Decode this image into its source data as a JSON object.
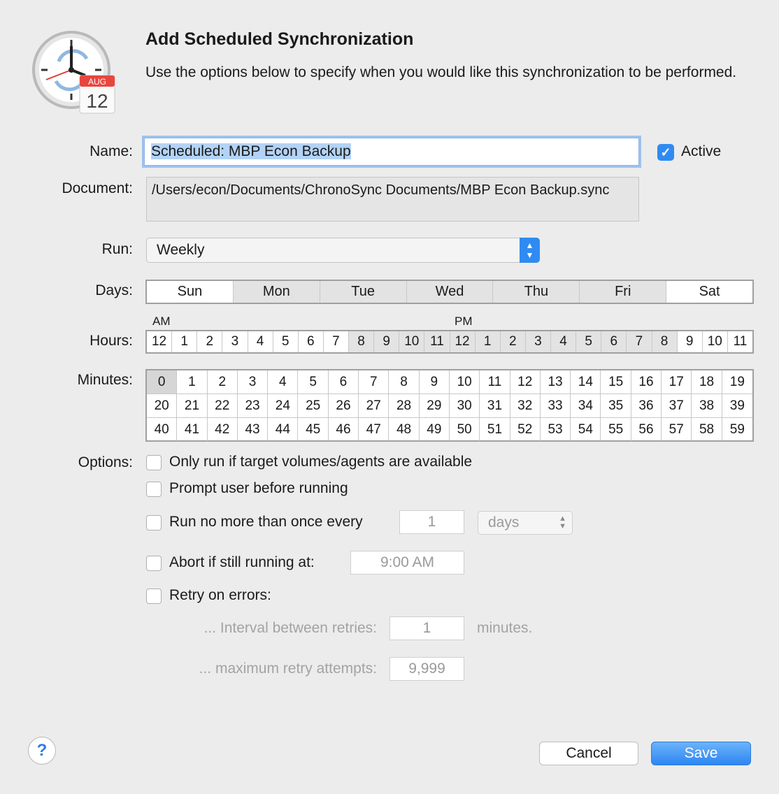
{
  "header": {
    "title": "Add Scheduled Synchronization",
    "subtitle": "Use the options below to specify when you would like this synchronization to be performed.",
    "icon_month": "AUG",
    "icon_day": "12"
  },
  "name": {
    "label": "Name:",
    "value": "Scheduled: MBP Econ Backup"
  },
  "active": {
    "label": "Active",
    "checked": true
  },
  "document": {
    "label": "Document:",
    "value": "/Users/econ/Documents/ChronoSync Documents/MBP Econ Backup.sync"
  },
  "run": {
    "label": "Run:",
    "value": "Weekly"
  },
  "days": {
    "label": "Days:",
    "items": [
      "Sun",
      "Mon",
      "Tue",
      "Wed",
      "Thu",
      "Fri",
      "Sat"
    ],
    "selected": [
      "Mon",
      "Tue",
      "Wed",
      "Thu",
      "Fri"
    ]
  },
  "hours": {
    "label": "Hours:",
    "am_label": "AM",
    "pm_label": "PM",
    "items": [
      "12",
      "1",
      "2",
      "3",
      "4",
      "5",
      "6",
      "7",
      "8",
      "9",
      "10",
      "11",
      "12",
      "1",
      "2",
      "3",
      "4",
      "5",
      "6",
      "7",
      "8",
      "9",
      "10",
      "11"
    ],
    "selected_indices": [
      8,
      9,
      10,
      11,
      12,
      13,
      14,
      15,
      16,
      17,
      18,
      19,
      20
    ]
  },
  "minutes": {
    "label": "Minutes:",
    "items": [
      "0",
      "1",
      "2",
      "3",
      "4",
      "5",
      "6",
      "7",
      "8",
      "9",
      "10",
      "11",
      "12",
      "13",
      "14",
      "15",
      "16",
      "17",
      "18",
      "19",
      "20",
      "21",
      "22",
      "23",
      "24",
      "25",
      "26",
      "27",
      "28",
      "29",
      "30",
      "31",
      "32",
      "33",
      "34",
      "35",
      "36",
      "37",
      "38",
      "39",
      "40",
      "41",
      "42",
      "43",
      "44",
      "45",
      "46",
      "47",
      "48",
      "49",
      "50",
      "51",
      "52",
      "53",
      "54",
      "55",
      "56",
      "57",
      "58",
      "59"
    ],
    "selected": [
      "0"
    ]
  },
  "options": {
    "label": "Options:",
    "only_run": "Only run if target volumes/agents are available",
    "prompt_user": "Prompt user before running",
    "run_no_more": "Run no more than once every",
    "run_no_more_value": "1",
    "run_no_more_unit": "days",
    "abort": "Abort if still running at:",
    "abort_value": "9:00 AM",
    "retry": "Retry on errors:",
    "interval_label": "... Interval between retries:",
    "interval_value": "1",
    "interval_unit": "minutes.",
    "max_label": "... maximum retry attempts:",
    "max_value": "9,999"
  },
  "buttons": {
    "help": "?",
    "cancel": "Cancel",
    "save": "Save"
  },
  "colors": {
    "accent": "#2f8bf2",
    "selected_cell": "#e3e3e3",
    "background": "#ececec"
  }
}
